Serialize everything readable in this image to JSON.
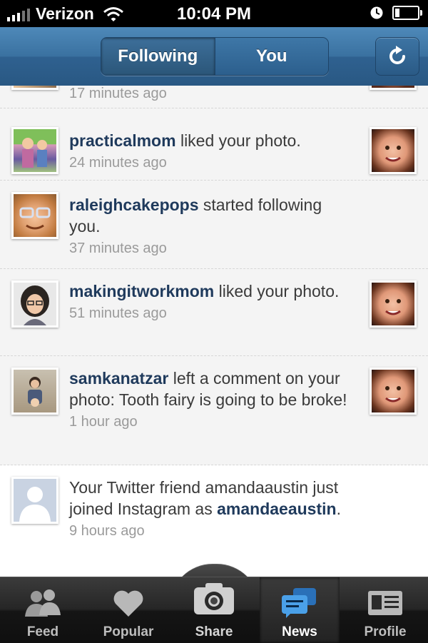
{
  "status_bar": {
    "carrier": "Verizon",
    "time": "10:04 PM"
  },
  "header": {
    "segments": [
      {
        "label": "Following",
        "active": true
      },
      {
        "label": "You",
        "active": false
      }
    ]
  },
  "feed": [
    {
      "user": "",
      "action": "",
      "time": "17 minutes ago",
      "avatar_icon": "user-avatar",
      "has_photo": true
    },
    {
      "user": "practicalmom",
      "action": " liked your photo.",
      "time": "24 minutes ago",
      "avatar_icon": "user-avatar",
      "has_photo": true
    },
    {
      "user": "raleighcakepops",
      "action": " started following you.",
      "time": "37 minutes ago",
      "avatar_icon": "user-avatar",
      "has_photo": false
    },
    {
      "user": "makingitworkmom",
      "action": " liked your photo.",
      "time": "51 minutes ago",
      "avatar_icon": "user-avatar",
      "has_photo": true
    },
    {
      "user": "samkanatzar",
      "action": " left a comment on your photo: Tooth fairy is going to be broke!",
      "time": "1 hour ago",
      "avatar_icon": "user-avatar",
      "has_photo": true
    },
    {
      "prefix": "Your Twitter friend amandaaustin just joined Instagram as ",
      "user": "amandaeaustin",
      "suffix": ".",
      "time": "9 hours ago",
      "avatar_icon": "default-avatar",
      "has_photo": false
    }
  ],
  "tabbar": {
    "tabs": [
      {
        "label": "Feed",
        "icon": "people-icon",
        "active": false
      },
      {
        "label": "Popular",
        "icon": "heart-icon",
        "active": false
      },
      {
        "label": "Share",
        "icon": "camera-icon",
        "active": false
      },
      {
        "label": "News",
        "icon": "speech-bubbles-icon",
        "active": true
      },
      {
        "label": "Profile",
        "icon": "id-card-icon",
        "active": false
      }
    ]
  },
  "colors": {
    "header_blue": "#3a71a0",
    "username": "#1f3a5c",
    "timestamp": "#9a9a9a",
    "news_icon_blue": "#3a8fd8"
  }
}
